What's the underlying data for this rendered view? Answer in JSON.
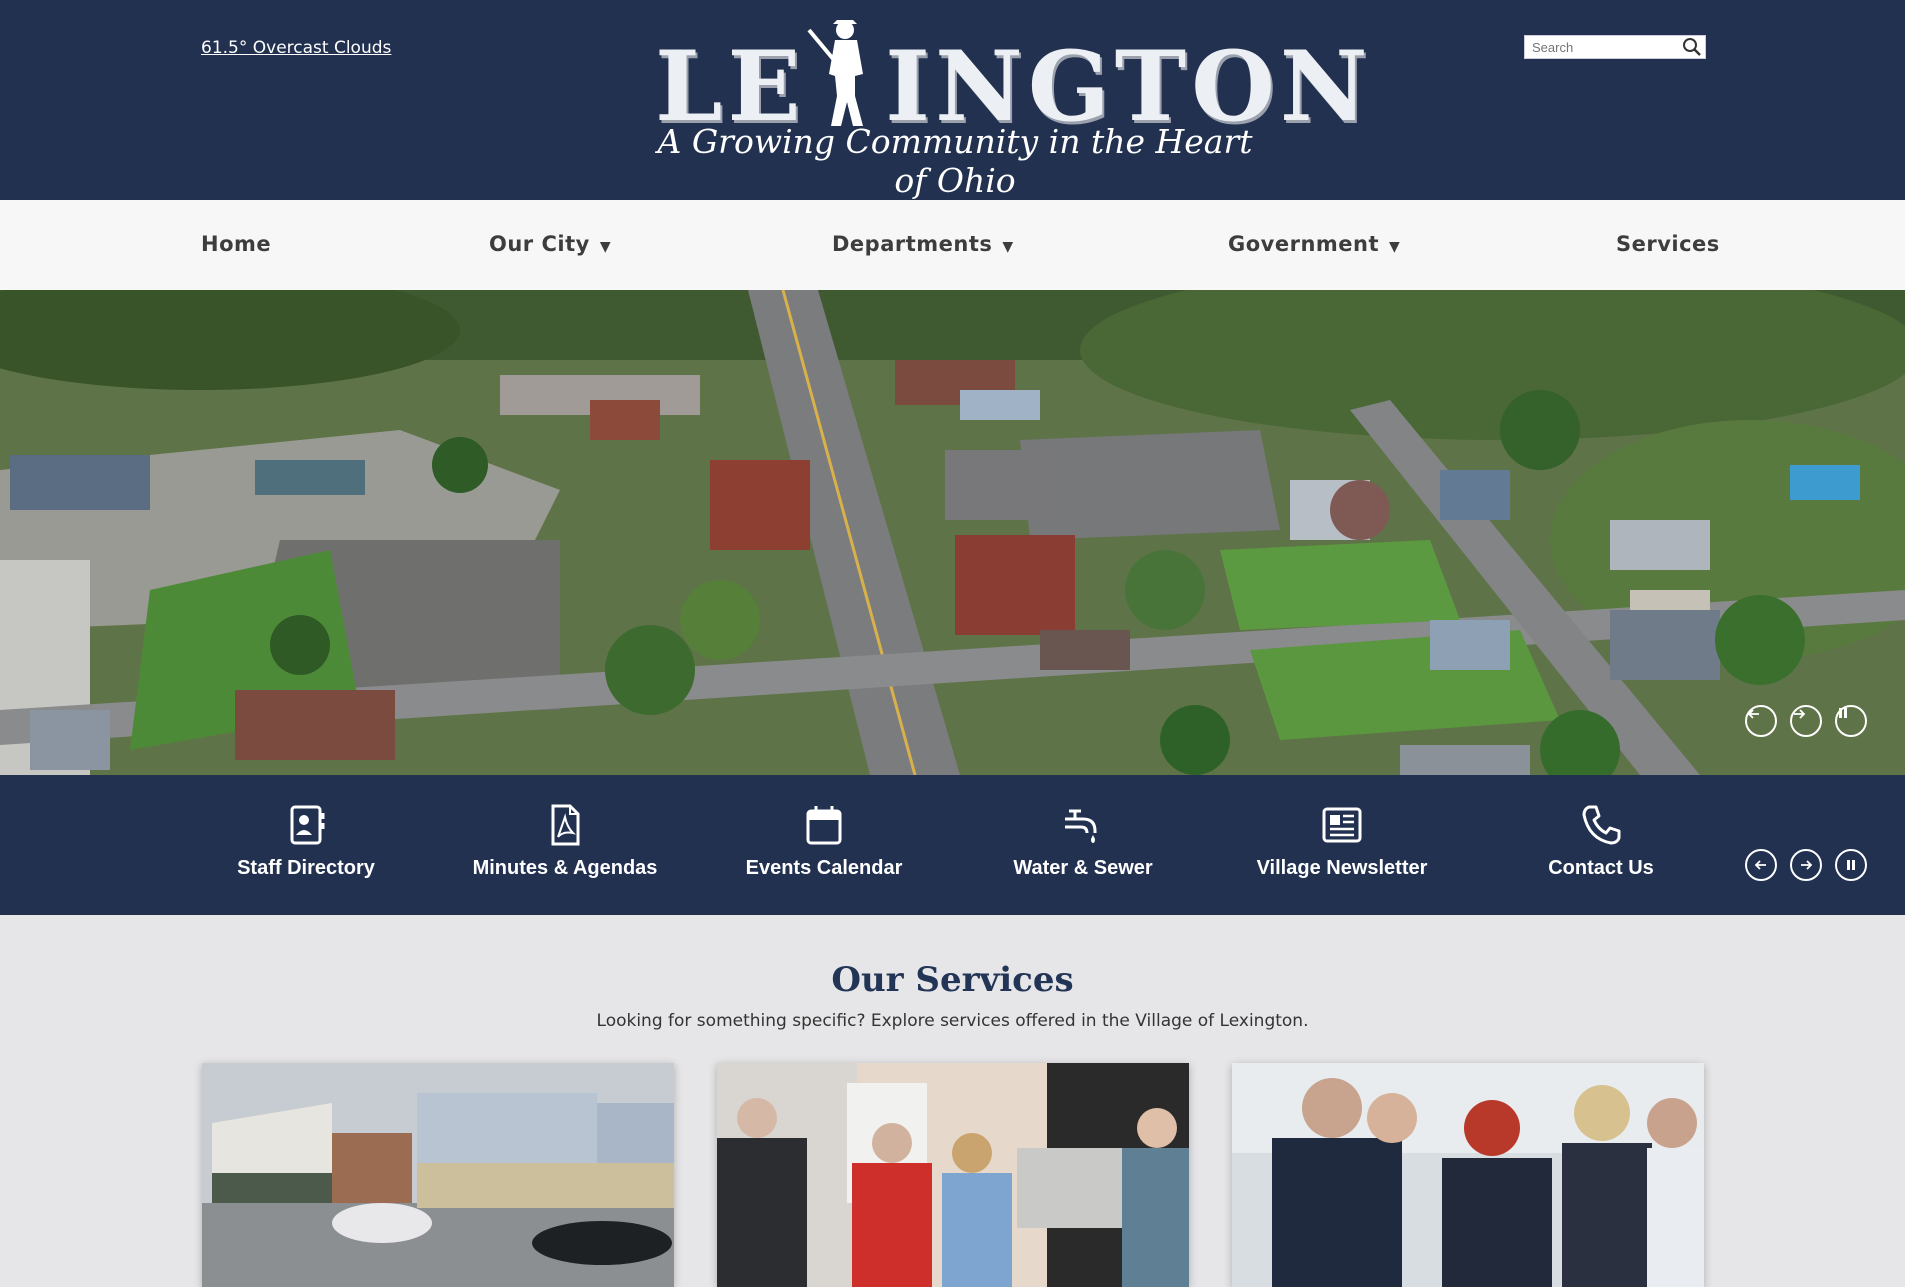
{
  "header": {
    "weather": "61.5°  Overcast Clouds",
    "logo_word": "LEXINGTON",
    "logo_tagline": "A Growing Community in the Heart of Ohio",
    "search_placeholder": "Search"
  },
  "nav": {
    "items": [
      {
        "label": "Home"
      },
      {
        "label": "Our City"
      },
      {
        "label": "Departments"
      },
      {
        "label": "Government"
      },
      {
        "label": "Services"
      }
    ],
    "caret": "▼"
  },
  "quicklinks": [
    {
      "label": "Staff Directory",
      "icon": "address-book-icon"
    },
    {
      "label": "Minutes & Agendas",
      "icon": "pdf-file-icon"
    },
    {
      "label": "Events Calendar",
      "icon": "calendar-icon"
    },
    {
      "label": "Water & Sewer",
      "icon": "faucet-icon"
    },
    {
      "label": "Village Newsletter",
      "icon": "newsletter-icon"
    },
    {
      "label": "Contact Us",
      "icon": "phone-icon"
    }
  ],
  "services": {
    "title": "Our Services",
    "subtitle": "Looking for something specific? Explore services offered in the Village of Lexington."
  },
  "colors": {
    "navy": "#223150",
    "title_navy": "#233556",
    "nav_bg": "#f7f7f7",
    "page_bg": "#e6e6e8"
  }
}
